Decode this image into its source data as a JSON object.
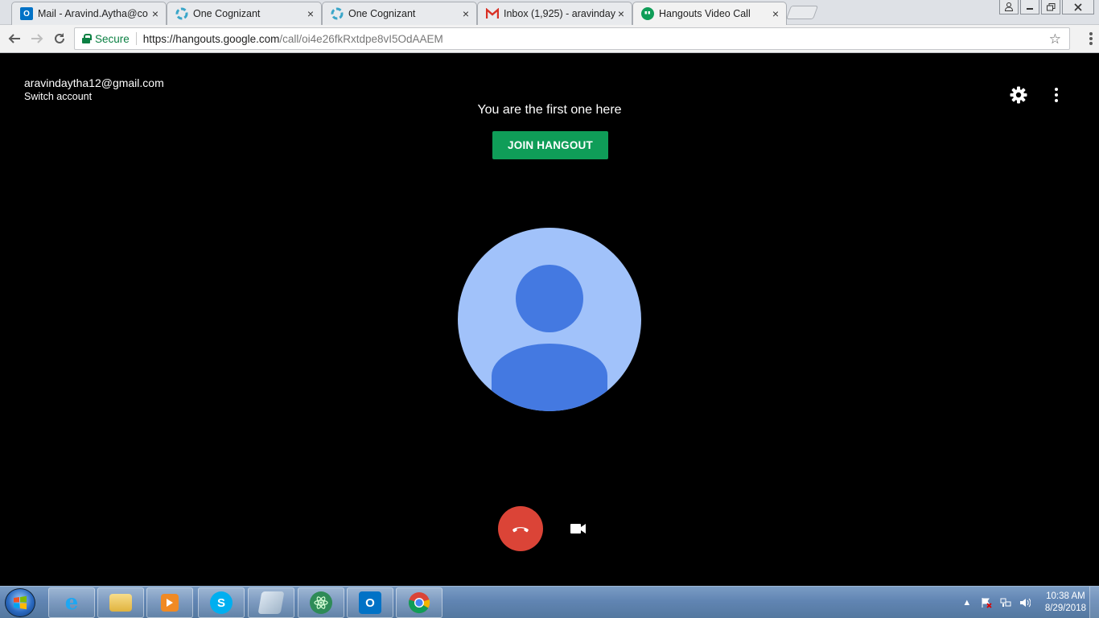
{
  "browser": {
    "tabs": [
      {
        "label": "Mail - Aravind.Aytha@co",
        "favicon": "outlook-icon",
        "active": false
      },
      {
        "label": "One Cognizant",
        "favicon": "cognizant-icon",
        "active": false
      },
      {
        "label": "One Cognizant",
        "favicon": "cognizant-icon",
        "active": false
      },
      {
        "label": "Inbox (1,925) - aravinday",
        "favicon": "gmail-icon",
        "active": false
      },
      {
        "label": "Hangouts Video Call",
        "favicon": "hangouts-icon",
        "active": true
      }
    ],
    "close_glyph": "×",
    "address": {
      "secure_label": "Secure",
      "url_scheme_host": "https://hangouts.google.com",
      "url_path": "/call/oi4e26fkRxtdpe8vI5OdAAEM"
    }
  },
  "page": {
    "account_email": "aravindaytha12@gmail.com",
    "switch_account": "Switch account",
    "status_message": "You are the first one here",
    "join_button": "JOIN HANGOUT",
    "colors": {
      "join": "#0f9d58",
      "hangup": "#db4437",
      "avatar_bg": "#a1c2fa",
      "avatar_fg": "#4479e1"
    }
  },
  "taskbar": {
    "items": [
      "internet-explorer-icon",
      "file-explorer-icon",
      "media-player-icon",
      "skype-icon",
      "notepad-icon",
      "atom-icon",
      "outlook-icon",
      "chrome-icon"
    ],
    "clock_time": "10:38 AM",
    "clock_date": "8/29/2018"
  }
}
